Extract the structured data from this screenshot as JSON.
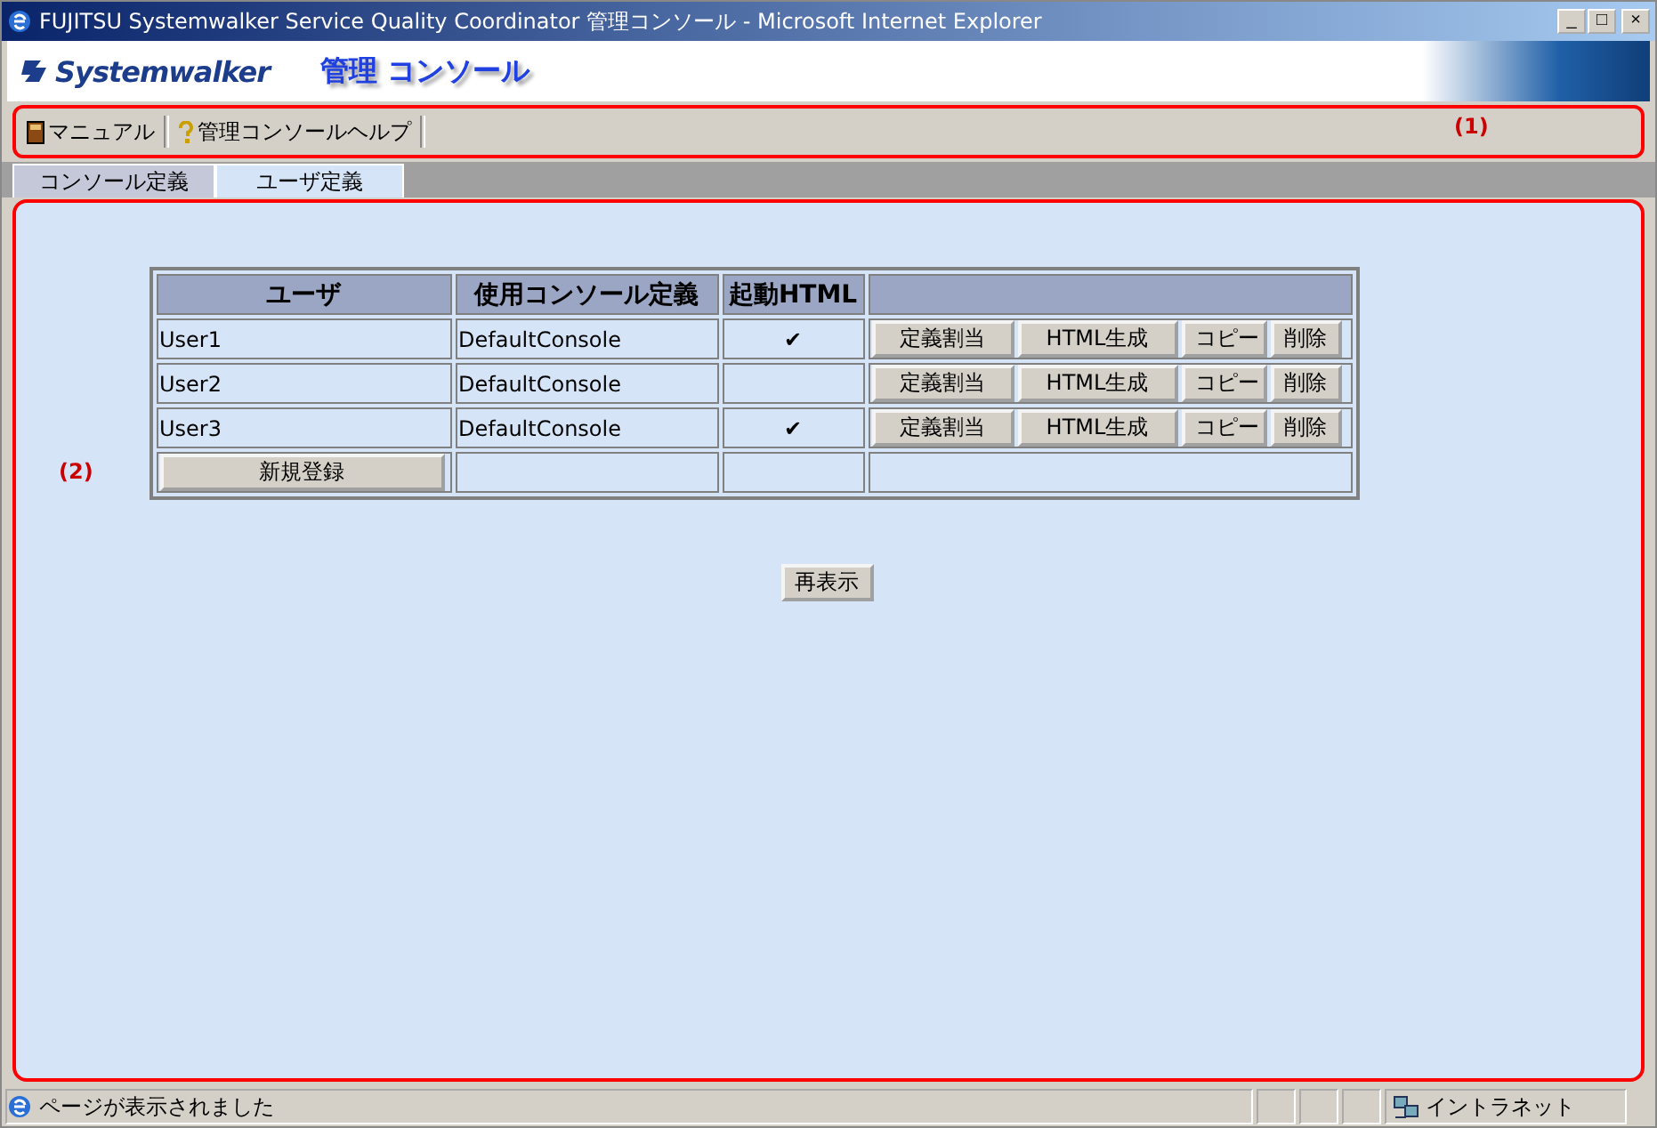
{
  "window": {
    "title": "FUJITSU Systemwalker Service Quality Coordinator 管理コンソール - Microsoft Internet Explorer",
    "controls": [
      "_",
      "□",
      "×"
    ]
  },
  "header": {
    "logo": "Systemwalker",
    "title": "管理 コンソール"
  },
  "toolbar": {
    "items": [
      {
        "kind": "book",
        "label": "マニュアル"
      },
      {
        "kind": "help",
        "label": "管理コンソールヘルプ"
      }
    ],
    "annotation": "(1)"
  },
  "tabs": [
    {
      "label": "コンソール定義",
      "selected": false
    },
    {
      "label": "ユーザ定義",
      "selected": true
    }
  ],
  "content": {
    "annotation": "(2)",
    "table": {
      "columns": [
        "ユーザ",
        "使用コンソール定義",
        "起動HTML"
      ],
      "rows": [
        {
          "user": "User1",
          "console": "DefaultConsole",
          "html": true,
          "buttons": [
            "定義割当",
            "HTML生成",
            "コピー",
            "削除"
          ]
        },
        {
          "user": "User2",
          "console": "DefaultConsole",
          "html": false,
          "buttons": [
            "定義割当",
            "HTML生成",
            "コピー",
            "削除"
          ]
        },
        {
          "user": "User3",
          "console": "DefaultConsole",
          "html": true,
          "buttons": [
            "定義割当",
            "HTML生成",
            "コピー",
            "削除"
          ]
        }
      ],
      "check_mark": "✔",
      "new_button": "新規登録"
    },
    "refresh_button": "再表示"
  },
  "status_bar": {
    "message": "ページが表示されました",
    "zone": "イントラネット"
  }
}
